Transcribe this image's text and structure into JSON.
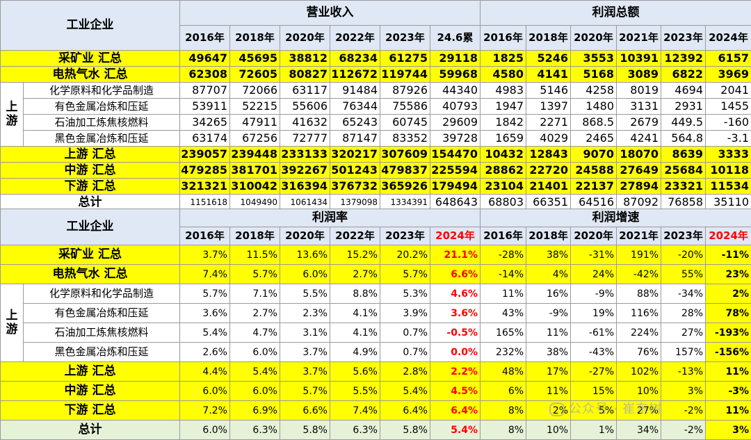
{
  "top": {
    "corner": "工业企业",
    "group_revenue": "营业收入",
    "group_profit": "利润总额",
    "revenue_years": [
      "2016年",
      "2018年",
      "2020年",
      "2022年",
      "2023年",
      "24.6累"
    ],
    "profit_years": [
      "2016年",
      "2018年",
      "2020年",
      "2021年",
      "2023年",
      "2024年"
    ],
    "upstream_mark": "上游",
    "rows": [
      {
        "label": "采矿业 汇总",
        "values": [
          "49647",
          "45695",
          "38812",
          "68234",
          "61275",
          "29118",
          "1825",
          "5246",
          "3553",
          "10391",
          "12392",
          "6157"
        ]
      },
      {
        "label": "电热气水 汇总",
        "values": [
          "62308",
          "72605",
          "80827",
          "112672",
          "119744",
          "59968",
          "4580",
          "4141",
          "5168",
          "3089",
          "6822",
          "3969"
        ]
      },
      {
        "label": "化学原料和化学品制造",
        "values": [
          "87707",
          "72066",
          "63117",
          "91484",
          "87926",
          "44340",
          "4983",
          "5146",
          "4258",
          "8019",
          "4694",
          "2041"
        ]
      },
      {
        "label": "有色金属冶炼和压延",
        "values": [
          "53911",
          "52215",
          "55606",
          "76344",
          "75586",
          "40793",
          "1947",
          "1397",
          "1480",
          "3131",
          "2931",
          "1455"
        ]
      },
      {
        "label": "石油加工炼焦核燃料",
        "values": [
          "34265",
          "47911",
          "41632",
          "65243",
          "60745",
          "29609",
          "1842",
          "2271",
          "868.5",
          "2679",
          "449.5",
          "-160"
        ]
      },
      {
        "label": "黑色金属冶炼和压延",
        "values": [
          "63174",
          "67256",
          "72777",
          "87147",
          "83352",
          "39728",
          "1659",
          "4029",
          "2465",
          "4241",
          "564.8",
          "-3.1"
        ]
      },
      {
        "label": "上游 汇总",
        "values": [
          "239057",
          "239448",
          "233133",
          "320217",
          "307609",
          "154470",
          "10432",
          "12843",
          "9070",
          "18070",
          "8639",
          "3333"
        ]
      },
      {
        "label": "中游 汇总",
        "values": [
          "479285",
          "381701",
          "392267",
          "501243",
          "479837",
          "225594",
          "28862",
          "22720",
          "24588",
          "27649",
          "25684",
          "10118"
        ]
      },
      {
        "label": "下游 汇总",
        "values": [
          "321321",
          "310042",
          "316394",
          "376732",
          "365926",
          "179494",
          "23104",
          "21401",
          "22137",
          "27894",
          "23321",
          "11534"
        ]
      },
      {
        "label": "总计",
        "values": [
          "1151618",
          "1049490",
          "1061434",
          "1379098",
          "1334391",
          "648643",
          "68803",
          "66351",
          "64516",
          "87092",
          "76858",
          "35110"
        ]
      }
    ]
  },
  "bottom": {
    "corner": "工业企业",
    "group_margin": "利润率",
    "group_growth": "利润增速",
    "margin_years": [
      "2016年",
      "2018年",
      "2020年",
      "2022年",
      "2023年",
      "2024年"
    ],
    "growth_years": [
      "2016年",
      "2018年",
      "2020年",
      "2021年",
      "2023年",
      "2024年"
    ],
    "upstream_mark": "上游",
    "rows": [
      {
        "label": "采矿业 汇总",
        "values": [
          "3.7%",
          "11.5%",
          "13.6%",
          "15.2%",
          "20.2%",
          "21.1%",
          "-28%",
          "38%",
          "-31%",
          "191%",
          "-20%",
          "-11%"
        ]
      },
      {
        "label": "电热气水 汇总",
        "values": [
          "7.4%",
          "5.7%",
          "6.0%",
          "2.7%",
          "5.7%",
          "6.6%",
          "-14%",
          "4%",
          "24%",
          "-42%",
          "55%",
          "23%"
        ]
      },
      {
        "label": "化学原料和化学品制造",
        "values": [
          "5.7%",
          "7.1%",
          "5.5%",
          "8.8%",
          "5.3%",
          "4.6%",
          "11%",
          "16%",
          "-9%",
          "88%",
          "-34%",
          "2%"
        ]
      },
      {
        "label": "有色金属冶炼和压延",
        "values": [
          "3.6%",
          "2.7%",
          "2.3%",
          "4.1%",
          "3.9%",
          "3.6%",
          "43%",
          "-9%",
          "19%",
          "116%",
          "28%",
          "78%"
        ]
      },
      {
        "label": "石油加工炼焦核燃料",
        "values": [
          "5.4%",
          "4.7%",
          "3.1%",
          "4.1%",
          "0.7%",
          "-0.5%",
          "165%",
          "11%",
          "-61%",
          "224%",
          "27%",
          "-193%"
        ]
      },
      {
        "label": "黑色金属冶炼和压延",
        "values": [
          "2.6%",
          "6.0%",
          "3.7%",
          "4.9%",
          "0.7%",
          "0.0%",
          "232%",
          "38%",
          "-43%",
          "76%",
          "157%",
          "-156%"
        ]
      },
      {
        "label": "上游 汇总",
        "values": [
          "4.4%",
          "5.4%",
          "3.7%",
          "5.6%",
          "2.8%",
          "2.2%",
          "48%",
          "17%",
          "-27%",
          "102%",
          "-13%",
          "11%"
        ]
      },
      {
        "label": "中游 汇总",
        "values": [
          "6.0%",
          "6.0%",
          "5.7%",
          "5.5%",
          "5.4%",
          "4.5%",
          "6%",
          "11%",
          "15%",
          "10%",
          "3%",
          "-3%"
        ]
      },
      {
        "label": "下游 汇总",
        "values": [
          "7.2%",
          "6.9%",
          "6.6%",
          "7.4%",
          "6.4%",
          "6.4%",
          "8%",
          "2%",
          "5%",
          "27%",
          "-2%",
          "11%"
        ]
      },
      {
        "label": "总计",
        "values": [
          "6.0%",
          "6.3%",
          "5.8%",
          "6.3%",
          "5.8%",
          "5.4%",
          "8%",
          "10%",
          "1%",
          "34%",
          "-2%",
          "3%"
        ]
      }
    ]
  },
  "watermark": "公众号 · 崔东树",
  "colors": {
    "yellow": "#ffff00",
    "header": "#dfe8f4",
    "total_green": "#e6f2d8",
    "red": "#ff0000"
  }
}
